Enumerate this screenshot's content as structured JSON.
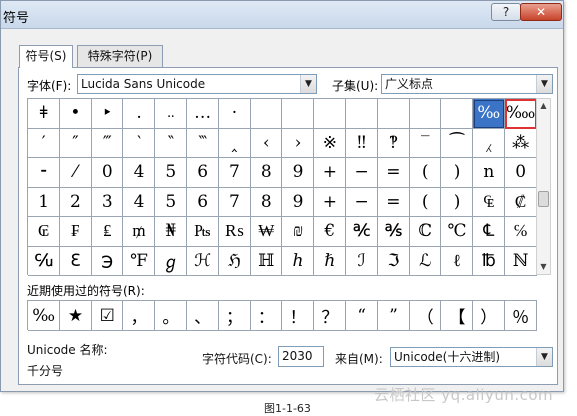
{
  "window": {
    "title": "符号",
    "help_label": "?",
    "close_label": "✕"
  },
  "tabs": [
    {
      "label": "符号(S)"
    },
    {
      "label": "特殊字符(P)"
    }
  ],
  "font": {
    "label": "字体(F):",
    "value": "Lucida Sans Unicode"
  },
  "subset": {
    "label": "子集(U):",
    "value": "广义标点"
  },
  "grid": {
    "rows": [
      [
        "ǂ",
        "•",
        "‣",
        ".",
        "..",
        "…",
        "·",
        "",
        "",
        "",
        "",
        "",
        "",
        "",
        "‰",
        "‱"
      ],
      [
        "′",
        "″",
        "‴",
        "‵",
        "‶",
        "‷",
        "‸",
        "‹",
        "›",
        "※",
        "‼",
        "‽",
        "‾",
        "⁀",
        "⁁",
        "⁂"
      ],
      [
        "⁃",
        "⁄",
        "0",
        "4",
        "5",
        "6",
        "7",
        "8",
        "9",
        "+",
        "−",
        "=",
        "(",
        ")",
        "n",
        "0"
      ],
      [
        "1",
        "2",
        "3",
        "4",
        "5",
        "6",
        "7",
        "8",
        "9",
        "+",
        "−",
        "=",
        "(",
        ")",
        "₠",
        "₡"
      ],
      [
        "₢",
        "₣",
        "₤",
        "₥",
        "₦",
        "₧",
        "₨",
        "₩",
        "₪",
        "€",
        "℀",
        "℁",
        "ℂ",
        "℃",
        "℄",
        "℅"
      ],
      [
        "℆",
        "ℇ",
        "℈",
        "℉",
        "ℊ",
        "ℋ",
        "ℌ",
        "ℍ",
        "ℎ",
        "ℏ",
        "ℐ",
        "ℑ",
        "ℒ",
        "ℓ",
        "℔",
        "ℕ"
      ]
    ],
    "selected": "‰",
    "hovered": "‱"
  },
  "recent": {
    "label": "近期使用过的符号(R):",
    "items": [
      "‰",
      "★",
      "☑",
      "，",
      "。",
      "、",
      "；",
      "：",
      "！",
      "？",
      "“",
      "”",
      "（",
      "【",
      "）",
      "％"
    ]
  },
  "unicode_name": {
    "label": "Unicode 名称:",
    "value": "千分号"
  },
  "char_code": {
    "label": "字符代码(C):",
    "value": "2030"
  },
  "from": {
    "label": "来自(M):",
    "value": "Unicode(十六进制)"
  },
  "watermark": "云栖社区 yq.aliyun.com",
  "caption": "图1-1-63"
}
